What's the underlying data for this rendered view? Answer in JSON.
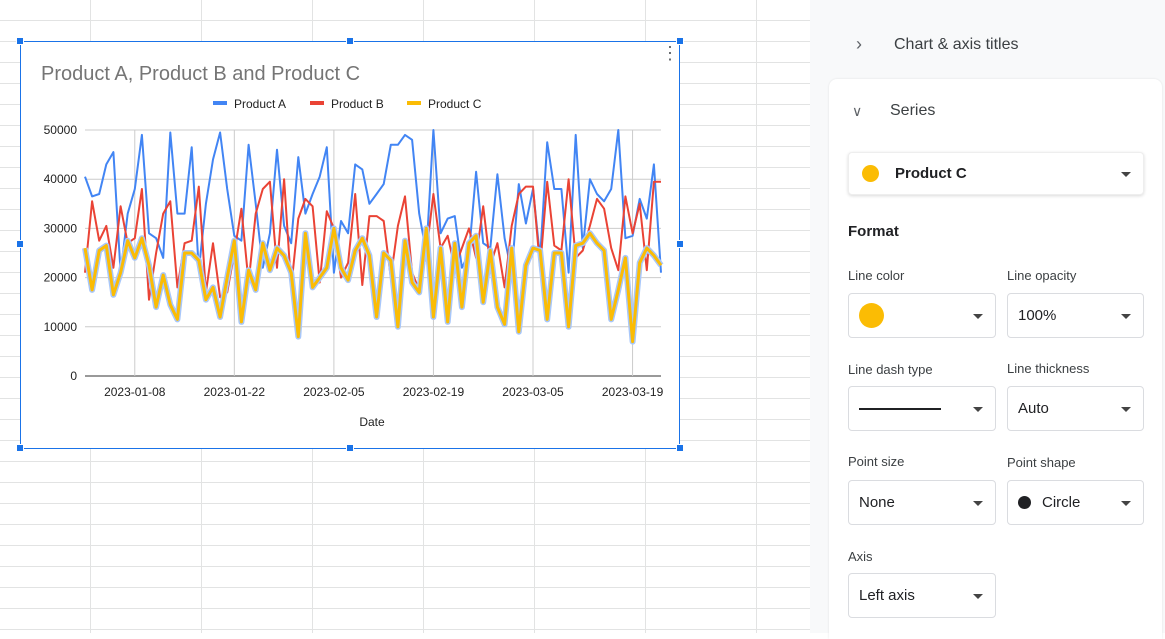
{
  "chart_data": {
    "type": "line",
    "title": "Product A, Product B and Product C",
    "xlabel": "Date",
    "ylabel": "",
    "ylim": [
      0,
      50000
    ],
    "yticks": [
      "0",
      "10000",
      "20000",
      "30000",
      "40000",
      "50000"
    ],
    "xrange": [
      "2023-01-01",
      "2023-03-23"
    ],
    "xticks": [
      "2023-01-08",
      "2023-01-22",
      "2023-02-05",
      "2023-02-19",
      "2023-03-05",
      "2023-03-19"
    ],
    "grid": true,
    "legend": "top",
    "series": [
      {
        "name": "Product A",
        "color": "#4285f4",
        "values": [
          40500,
          36500,
          37000,
          43000,
          45500,
          21000,
          33000,
          38000,
          49000,
          29000,
          28000,
          24000,
          49500,
          33000,
          33000,
          46500,
          21500,
          35000,
          44000,
          49500,
          38000,
          28500,
          27500,
          47000,
          35000,
          22000,
          29000,
          46000,
          30500,
          27000,
          44500,
          33000,
          37000,
          40500,
          46500,
          21000,
          31500,
          29000,
          43000,
          42000,
          35000,
          37000,
          39000,
          47000,
          47000,
          49000,
          48000,
          33000,
          25000,
          50000,
          29000,
          32000,
          32500,
          22000,
          25000,
          41500,
          27000,
          26000,
          41000,
          28000,
          21000,
          39000,
          31000,
          38000,
          24000,
          47500,
          38000,
          38000,
          21000,
          49000,
          26000,
          40000,
          37000,
          35500,
          38000,
          50000,
          28000,
          28500,
          36000,
          32000,
          43000,
          21000
        ]
      },
      {
        "name": "Product B",
        "color": "#ea4335",
        "values": [
          21000,
          35500,
          27500,
          30500,
          22000,
          34500,
          27000,
          28000,
          38000,
          15500,
          25000,
          33000,
          35500,
          18000,
          27000,
          27500,
          38500,
          17000,
          27000,
          16000,
          17000,
          25000,
          34000,
          19000,
          33000,
          38000,
          39500,
          22000,
          40000,
          18000,
          32000,
          36000,
          34500,
          19000,
          33500,
          30000,
          20000,
          23000,
          37000,
          18500,
          32500,
          32500,
          31500,
          20000,
          30500,
          36500,
          21000,
          17500,
          25000,
          37000,
          26000,
          28500,
          22000,
          26000,
          30000,
          24000,
          34500,
          22500,
          27000,
          18000,
          30500,
          37000,
          38500,
          38500,
          22000,
          39500,
          26500,
          25500,
          40000,
          24000,
          25500,
          30500,
          36000,
          34000,
          26000,
          21500,
          36500,
          29000,
          35000,
          21500,
          39500,
          39500
        ]
      },
      {
        "name": "Product C",
        "color": "#fbbc04",
        "values": [
          26000,
          17500,
          25500,
          26500,
          16500,
          21000,
          27500,
          24000,
          28000,
          22500,
          14000,
          20500,
          14500,
          11500,
          25000,
          25000,
          23500,
          15500,
          18000,
          12000,
          20000,
          27500,
          11000,
          21500,
          17500,
          27000,
          21500,
          26000,
          24500,
          21000,
          8000,
          29000,
          18000,
          20000,
          22000,
          30000,
          22000,
          19500,
          25500,
          28000,
          24500,
          12000,
          25000,
          23500,
          10000,
          27500,
          19000,
          17000,
          30000,
          12000,
          26000,
          11000,
          27000,
          14000,
          27000,
          28500,
          15000,
          25500,
          14000,
          10500,
          26000,
          9000,
          22500,
          26000,
          25500,
          11500,
          25000,
          25000,
          10000,
          26500,
          27000,
          29000,
          27000,
          25500,
          11500,
          17500,
          24000,
          7000,
          23000,
          26000,
          24500,
          22500
        ]
      }
    ]
  },
  "panel": {
    "chart_axis_titles": "Chart & axis titles",
    "series_section": "Series",
    "selected_series": "Product C",
    "selected_series_color": "#fbbc04",
    "format_heading": "Format",
    "line_color_label": "Line color",
    "line_color": "#fbbc04",
    "line_opacity_label": "Line opacity",
    "line_opacity": "100%",
    "line_dash_label": "Line dash type",
    "line_thickness_label": "Line thickness",
    "line_thickness": "Auto",
    "point_size_label": "Point size",
    "point_size": "None",
    "point_shape_label": "Point shape",
    "point_shape": "Circle",
    "axis_label": "Axis",
    "axis": "Left axis"
  }
}
